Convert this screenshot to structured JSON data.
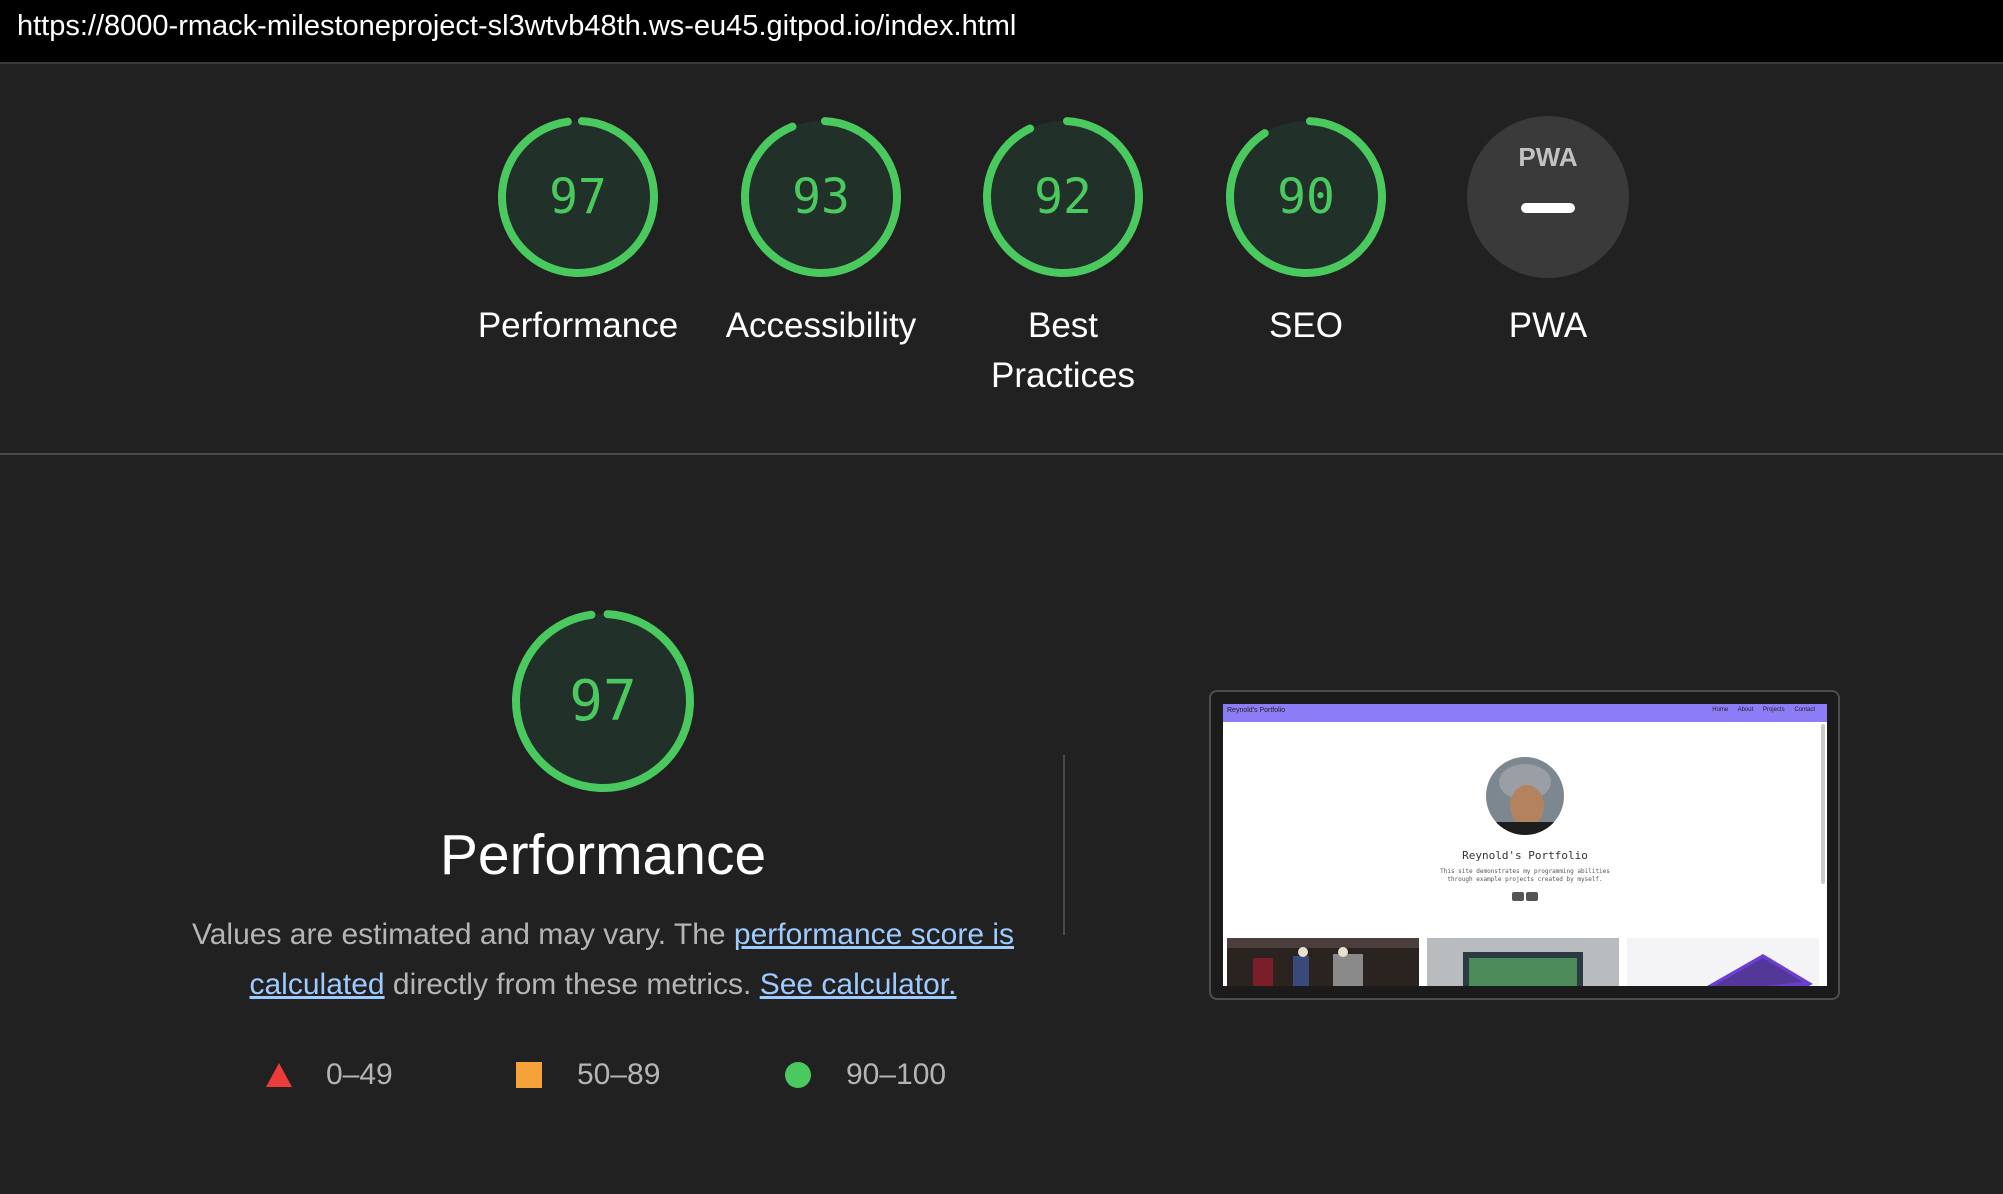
{
  "browser": {
    "url": "https://8000-rmack-milestoneproject-sl3wtvb48th.ws-eu45.gitpod.io/index.html"
  },
  "categories": [
    {
      "label": "Performance",
      "score": 97,
      "color": "#4ac95e"
    },
    {
      "label": "Accessibility",
      "score": 93,
      "color": "#4ac95e"
    },
    {
      "label": "Best Practices",
      "score": 92,
      "color": "#4ac95e"
    },
    {
      "label": "SEO",
      "score": 90,
      "color": "#4ac95e"
    },
    {
      "label": "PWA",
      "badge": "PWA"
    }
  ],
  "performance": {
    "score": 97,
    "title": "Performance",
    "desc_prefix": "Values are estimated and may vary. The ",
    "score_link": "performance score is calculated",
    "desc_middle": " directly from these metrics. ",
    "calculator_link": "See calculator."
  },
  "legend": [
    {
      "range": "0–49",
      "icon": "triangle-icon",
      "color": "#eb3b3b"
    },
    {
      "range": "50–89",
      "icon": "square-icon",
      "color": "#f5a338"
    },
    {
      "range": "90–100",
      "icon": "circle-icon",
      "color": "#4ac95e"
    }
  ],
  "screenshot": {
    "brand": "Reynold's Portfolio",
    "nav_links": [
      "Home",
      "About",
      "Projects",
      "Contact"
    ],
    "name": "Reynold's Portfolio",
    "subtitle_line1": "This site demonstrates my programming abilities",
    "subtitle_line2": "through example projects created by myself."
  },
  "colors": {
    "background": "#212121",
    "pass": "#4ac95e",
    "pass_fill": "#22302a",
    "link": "#9ecaff"
  }
}
